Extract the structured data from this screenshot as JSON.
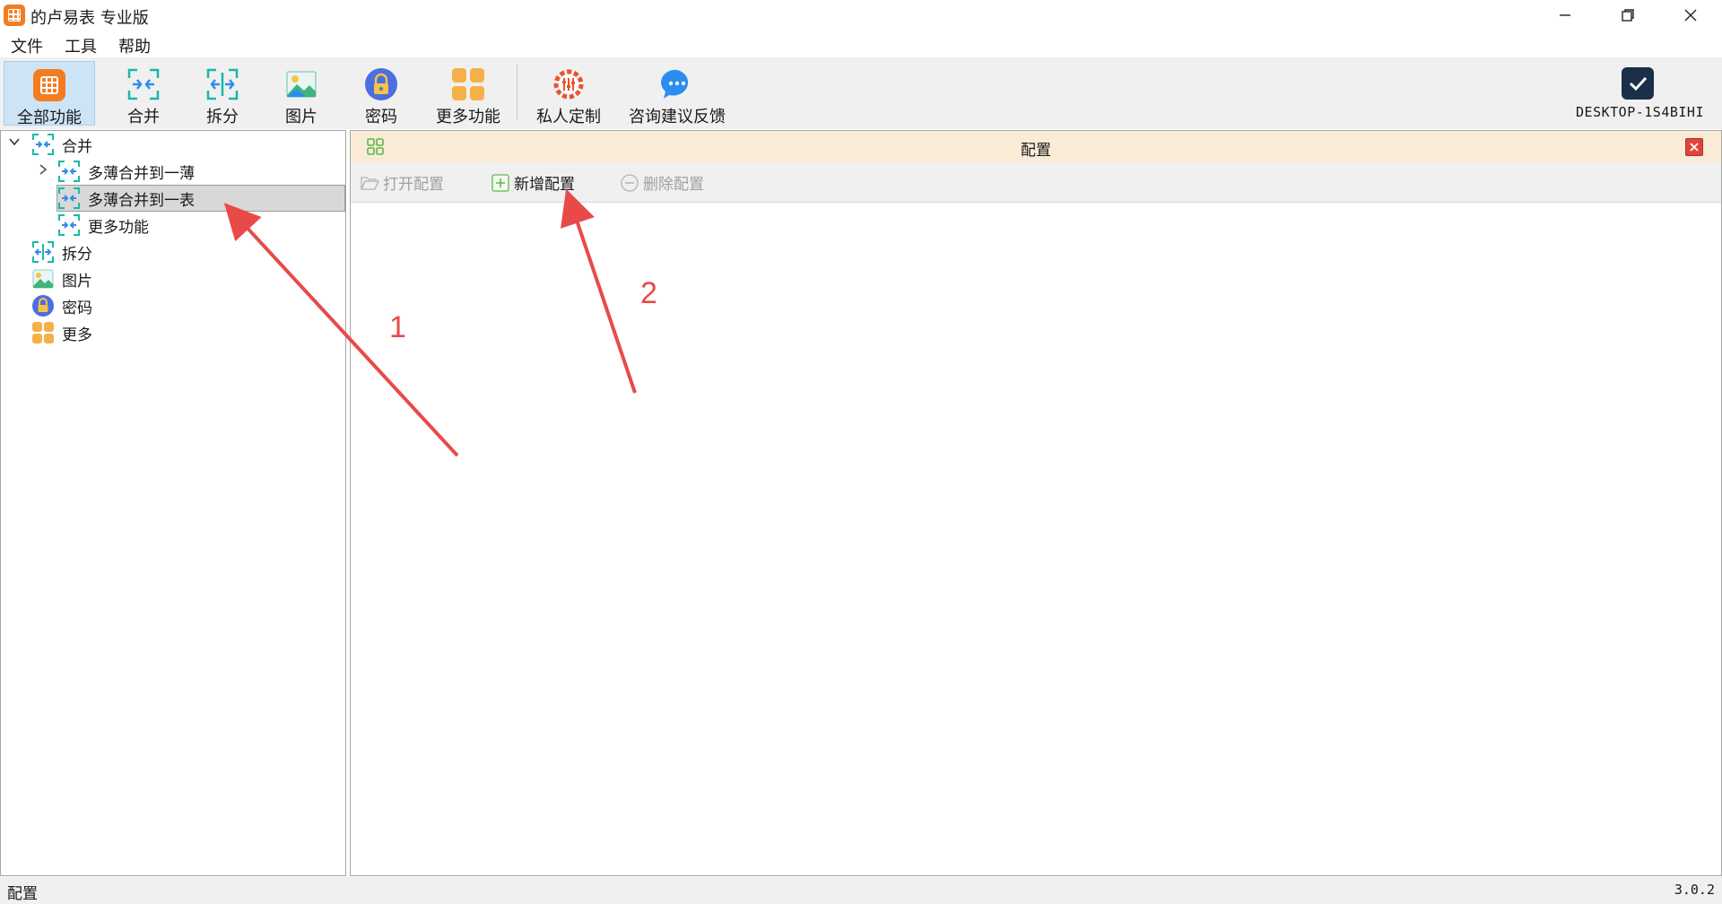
{
  "window": {
    "title": "的卢易表 专业版"
  },
  "menu": [
    "文件",
    "工具",
    "帮助"
  ],
  "toolbar": {
    "all": "全部功能",
    "merge": "合并",
    "split": "拆分",
    "image": "图片",
    "password": "密码",
    "more": "更多功能",
    "custom": "私人定制",
    "feedback": "咨询建议反馈",
    "desktop": "DESKTOP-1S4BIHI"
  },
  "tree": {
    "merge": "合并",
    "merge_children": [
      "多薄合并到一薄",
      "多薄合并到一表",
      "更多功能"
    ],
    "split": "拆分",
    "image": "图片",
    "password": "密码",
    "more": "更多"
  },
  "panel": {
    "title": "配置",
    "open": "打开配置",
    "add": "新增配置",
    "delete": "删除配置"
  },
  "status": {
    "left": "配置",
    "version": "3.0.2"
  },
  "annotations": {
    "one": "1",
    "two": "2"
  },
  "colors": {
    "accent_orange": "#f47c20",
    "teal": "#18b8a8",
    "annotation_red": "#e84a4a",
    "panel_header": "#faebd7"
  }
}
